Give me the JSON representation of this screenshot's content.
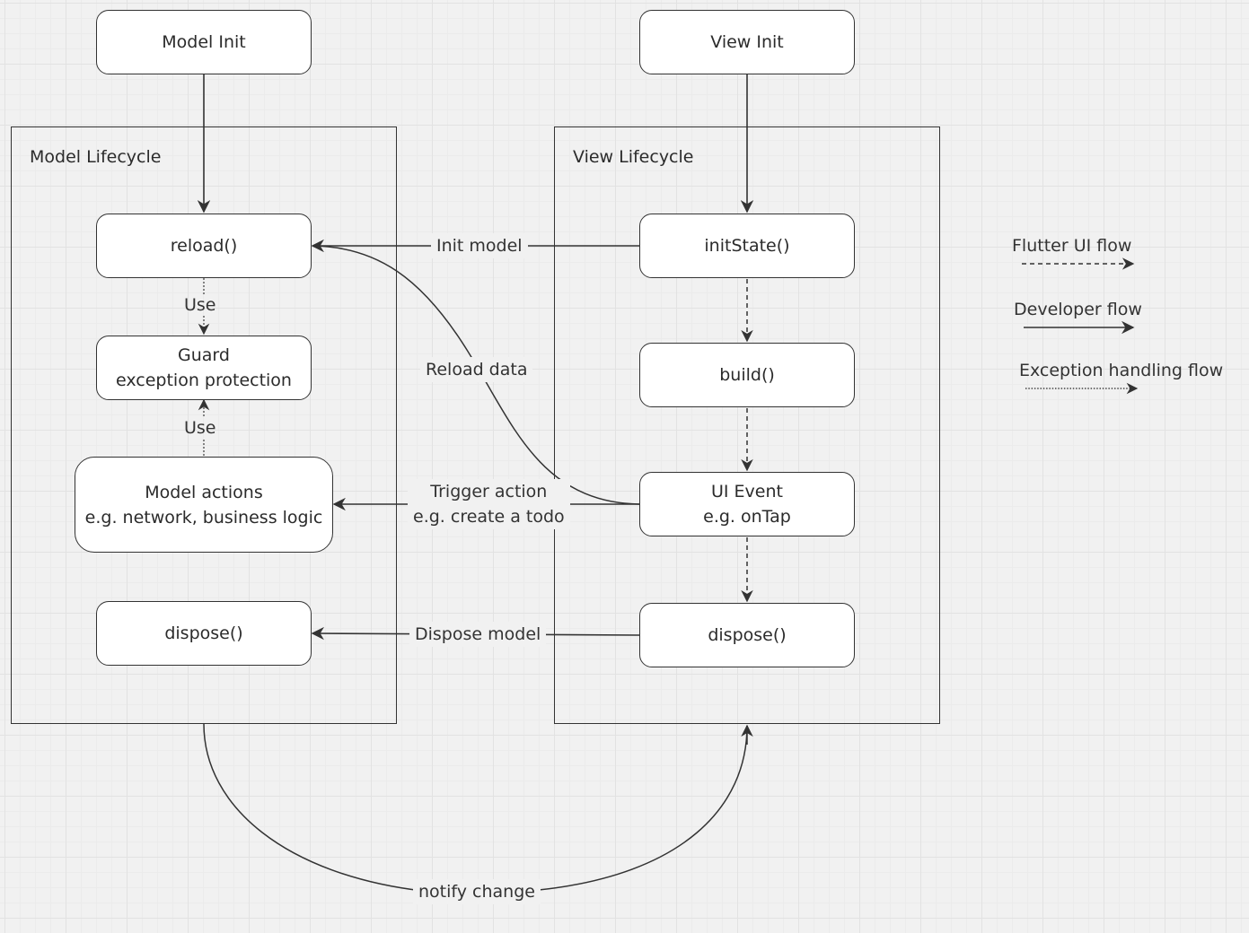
{
  "containers": {
    "model": {
      "title": "Model Lifecycle"
    },
    "view": {
      "title": "View Lifecycle"
    }
  },
  "nodes": {
    "model_init": "Model Init",
    "view_init": "View Init",
    "reload": "reload()",
    "guard_line1": "Guard",
    "guard_line2": "exception protection",
    "model_actions_line1": "Model actions",
    "model_actions_line2": "e.g. network, business logic",
    "model_dispose": "dispose()",
    "init_state": "initState()",
    "build": "build()",
    "ui_event_line1": "UI Event",
    "ui_event_line2": "e.g. onTap",
    "view_dispose": "dispose()"
  },
  "edges": {
    "use_1": "Use",
    "use_2": "Use",
    "init_model": "Init model",
    "reload_data": "Reload data",
    "trigger_action_line1": "Trigger action",
    "trigger_action_line2": "e.g. create a todo",
    "dispose_model": "Dispose model",
    "notify_change": "notify change"
  },
  "legend": {
    "flutter_ui_flow": "Flutter UI flow",
    "developer_flow": "Developer flow",
    "exception_handling_flow": "Exception handling flow"
  },
  "colors": {
    "stroke": "#333333",
    "node_fill": "#ffffff",
    "canvas": "#f1f1f1"
  }
}
